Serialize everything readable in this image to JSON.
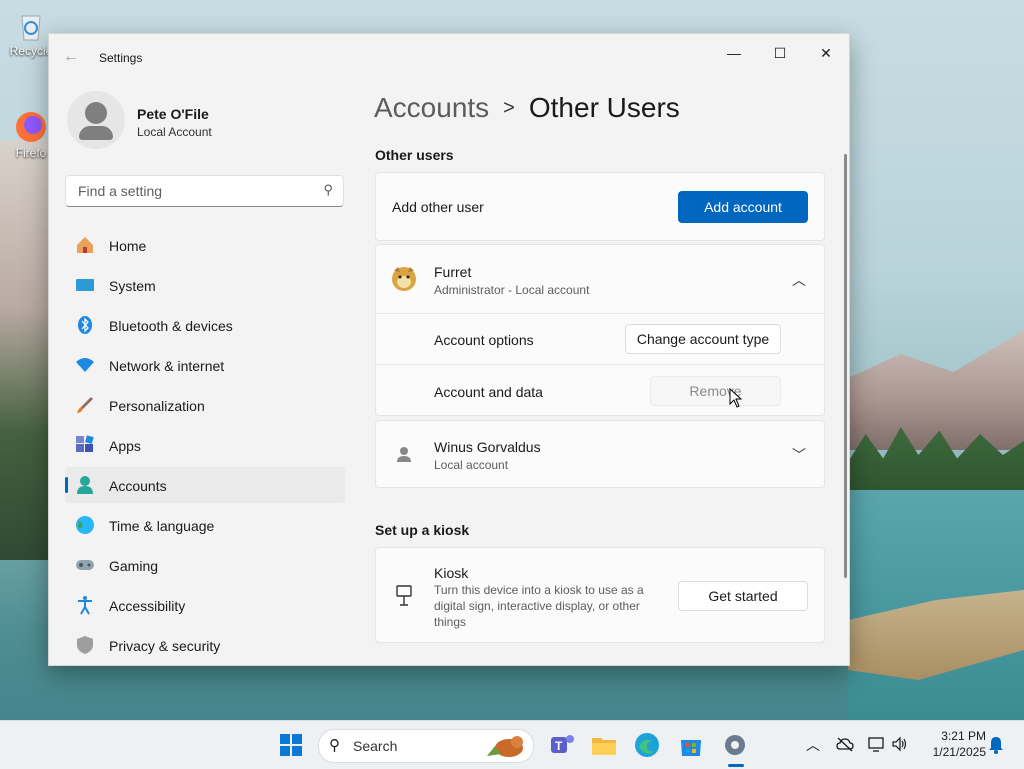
{
  "desktop": {
    "icons": [
      {
        "label": "Recycle",
        "icon": "recycle-bin-icon"
      },
      {
        "label": "Firefo",
        "icon": "firefox-icon"
      }
    ]
  },
  "window": {
    "title": "Settings",
    "controls": {
      "minimize": "—",
      "maximize": "☐",
      "close": "✕"
    }
  },
  "profile": {
    "name": "Pete O'File",
    "type": "Local Account"
  },
  "search": {
    "placeholder": "Find a setting"
  },
  "nav": [
    {
      "label": "Home",
      "icon": "home-icon"
    },
    {
      "label": "System",
      "icon": "system-icon"
    },
    {
      "label": "Bluetooth & devices",
      "icon": "bluetooth-icon"
    },
    {
      "label": "Network & internet",
      "icon": "wifi-icon"
    },
    {
      "label": "Personalization",
      "icon": "brush-icon"
    },
    {
      "label": "Apps",
      "icon": "apps-icon"
    },
    {
      "label": "Accounts",
      "icon": "accounts-icon",
      "selected": true
    },
    {
      "label": "Time & language",
      "icon": "globe-icon"
    },
    {
      "label": "Gaming",
      "icon": "gamepad-icon"
    },
    {
      "label": "Accessibility",
      "icon": "accessibility-icon"
    },
    {
      "label": "Privacy & security",
      "icon": "shield-icon"
    }
  ],
  "breadcrumb": {
    "parent": "Accounts",
    "separator": ">",
    "current": "Other Users"
  },
  "other_users": {
    "section_title": "Other users",
    "add_row": {
      "label": "Add other user",
      "button": "Add account"
    },
    "users": [
      {
        "name": "Furret",
        "subtitle": "Administrator - Local account",
        "expanded": true,
        "options": [
          {
            "label": "Account options",
            "button": "Change account type",
            "enabled": true
          },
          {
            "label": "Account and data",
            "button": "Remove",
            "enabled": false
          }
        ]
      },
      {
        "name": "Winus Gorvaldus",
        "subtitle": "Local account",
        "expanded": false
      }
    ]
  },
  "kiosk": {
    "section_title": "Set up a kiosk",
    "title": "Kiosk",
    "description_lines": [
      "Turn this device into a kiosk to use as a",
      "digital sign, interactive display, or other",
      "things"
    ],
    "button": "Get started"
  },
  "taskbar": {
    "search_label": "Search",
    "clock_time": "3:21 PM",
    "clock_date": "1/21/2025"
  },
  "colors": {
    "accent": "#0067c0"
  }
}
